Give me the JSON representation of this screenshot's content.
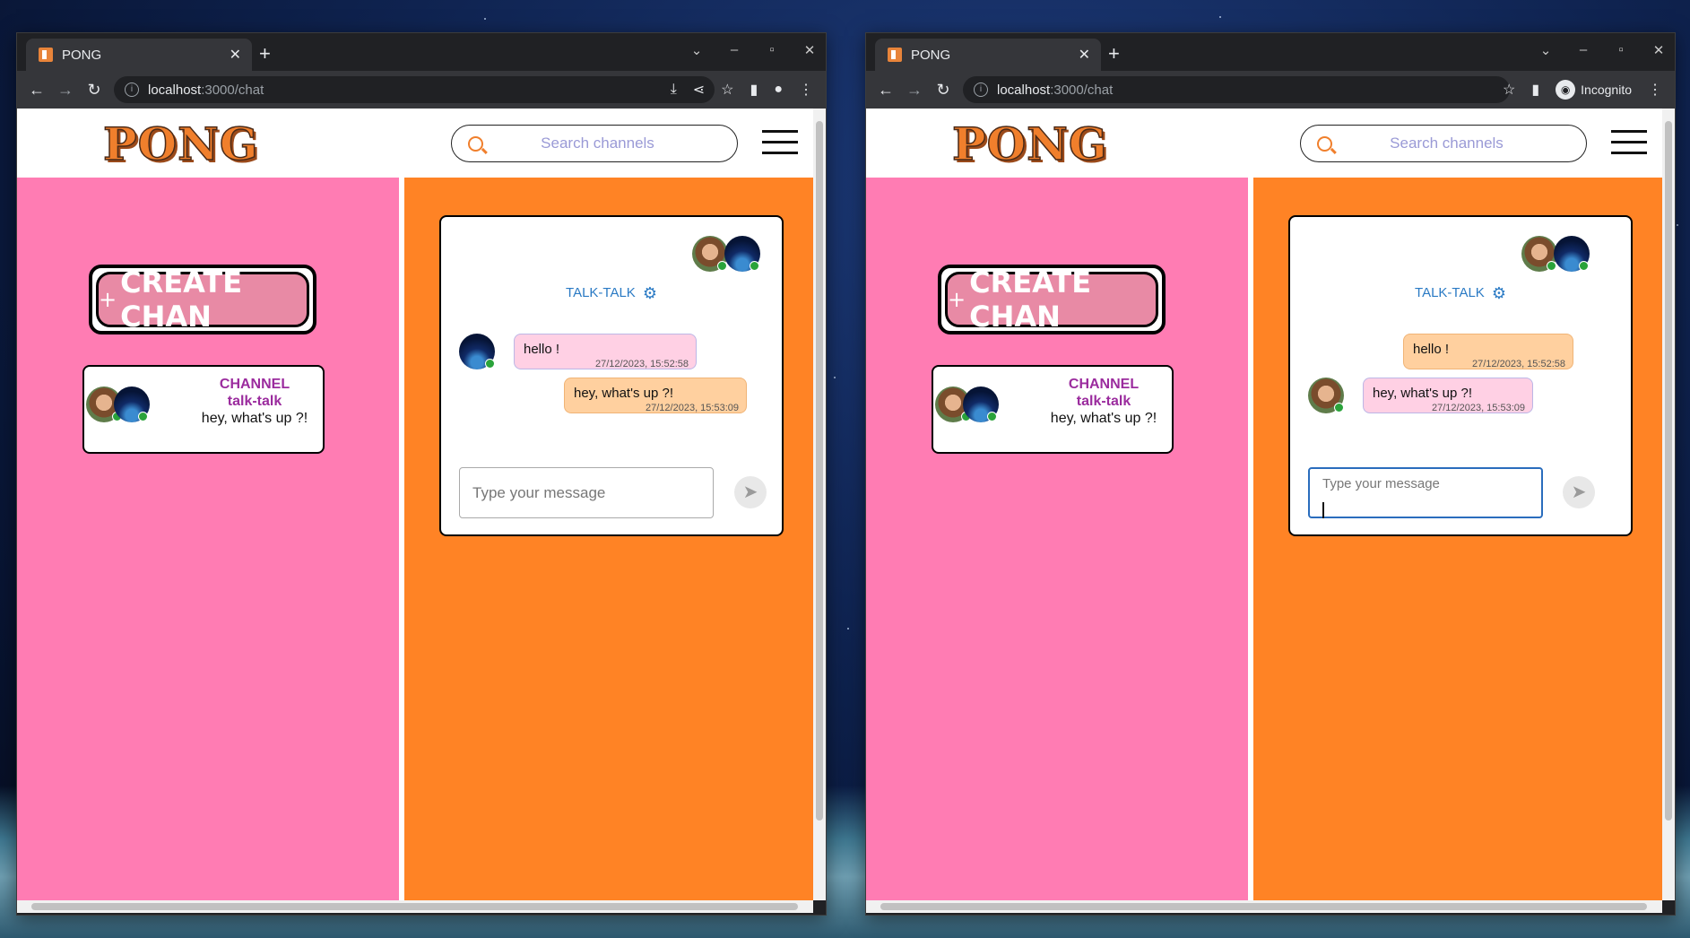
{
  "windows": [
    {
      "tab_title": "PONG",
      "url_host": "localhost",
      "url_path": ":3000/chat",
      "incognito_label": "",
      "header": {
        "logo": "PONG",
        "search_placeholder": "Search channels"
      },
      "create_button": {
        "plus": "+",
        "label": "CREATE CHAN"
      },
      "channel_card": {
        "kind": "CHANNEL",
        "name": "talk-talk",
        "last_message": "hey, what's up ?!"
      },
      "chat": {
        "title": "TALK-TALK",
        "messages": [
          {
            "text": "hello !",
            "time": "27/12/2023, 15:52:58"
          },
          {
            "text": "hey, what's up ?!",
            "time": "27/12/2023, 15:53:09"
          }
        ],
        "input_placeholder": "Type your message"
      }
    },
    {
      "tab_title": "PONG",
      "url_host": "localhost",
      "url_path": ":3000/chat",
      "incognito_label": "Incognito",
      "header": {
        "logo": "PONG",
        "search_placeholder": "Search channels"
      },
      "create_button": {
        "plus": "+",
        "label": "CREATE CHAN"
      },
      "channel_card": {
        "kind": "CHANNEL",
        "name": "talk-talk",
        "last_message": "hey, what's up ?!"
      },
      "chat": {
        "title": "TALK-TALK",
        "messages": [
          {
            "text": "hello !",
            "time": "27/12/2023, 15:52:58"
          },
          {
            "text": "hey, what's up ?!",
            "time": "27/12/2023, 15:53:09"
          }
        ],
        "input_placeholder": "Type your message"
      }
    }
  ],
  "colors": {
    "left_panel": "#ff7cb3",
    "right_panel": "#ff8325",
    "bubble_pink": "#ffd0e4",
    "bubble_peach": "#ffd09f",
    "chat_title": "#2a7ac4",
    "channel_text": "#9b2c9e",
    "logo": "#f07f2c",
    "online_dot": "#2aa33a"
  }
}
